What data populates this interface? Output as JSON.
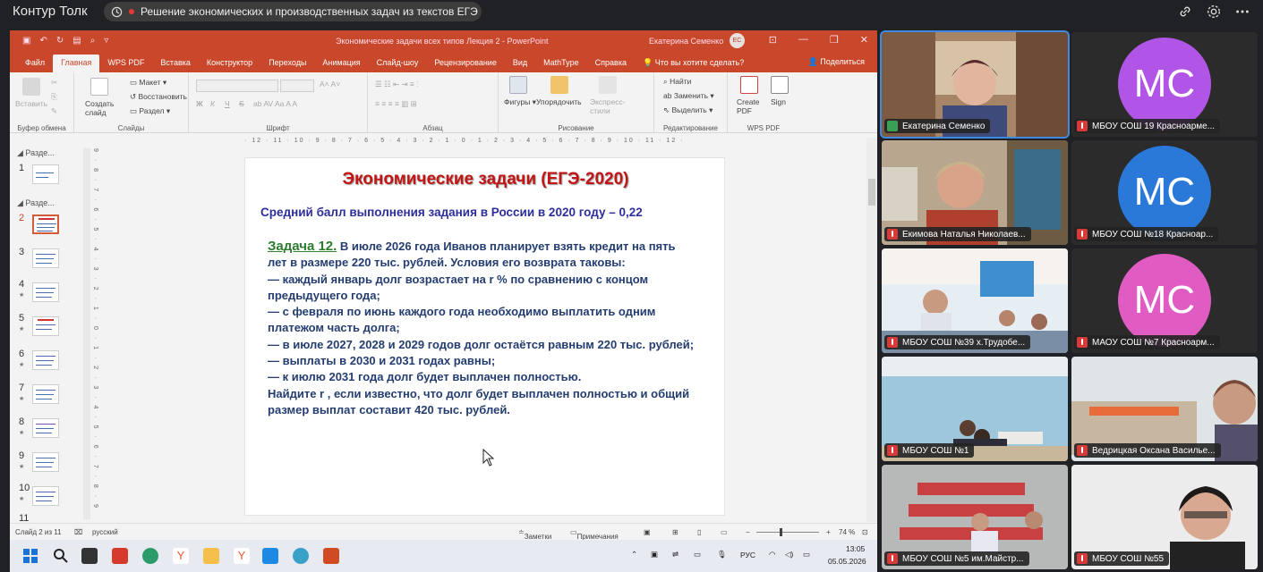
{
  "topbar": {
    "app_title": "Контур Толк",
    "meeting_title": "Решение экономических и производственных задач из текстов ЕГЭ"
  },
  "ppt": {
    "doc_title": "Экономические задачи всех типов Лекция 2  -  PowerPoint",
    "user_name": "Екатерина Семенко",
    "user_initials": "ЕС",
    "tabs": [
      "Файл",
      "Главная",
      "WPS PDF",
      "Вставка",
      "Конструктор",
      "Переходы",
      "Анимация",
      "Слайд-шоу",
      "Рецензирование",
      "Вид",
      "MathType",
      "Справка",
      "Что вы хотите сделать?"
    ],
    "share_label": "Поделиться",
    "ribbon": {
      "insert_label": "Вставить",
      "create_slide_label": "Создать слайд",
      "layout_label": "Макет",
      "restore_label": "Восстановить",
      "section_label": "Раздел",
      "shapes_label": "Фигуры",
      "arrange_label": "Упорядочить",
      "express_styles_label": "Экспресс-стили",
      "find_label": "Найти",
      "replace_label": "Заменить",
      "select_label": "Выделить",
      "create_pdf_label": "Create PDF",
      "sign_label": "Sign",
      "font_bold": "Ж",
      "font_italic": "К",
      "font_underline": "Ч",
      "font_strike": "S",
      "groups": {
        "clipboard": "Буфер обмена",
        "slides": "Слайды",
        "font": "Шрифт",
        "paragraph": "Абзац",
        "drawing": "Рисование",
        "editing": "Редактирование",
        "wpspdf": "WPS PDF"
      }
    },
    "ruler_text": "· 12 · 11 · 10 · 9 · 8 · 7 · 6 · 5 · 4 · 3 · 2 · 1 · 0 · 1 · 2 · 3 · 4 · 5 · 6 · 7 · 8 · 9 · 10 · 11 · 12 ·",
    "vruler_text": "9 · 8 · 7 · 6 · 5 · 4 · 3 · 2 · 1 · 0 · 1 · 2 · 3 · 4 · 5 · 6 · 7 · 8 · 9",
    "thumbs": {
      "section1": "Разде...",
      "section2": "Разде...",
      "numbers": [
        "1",
        "2",
        "3",
        "4",
        "5",
        "6",
        "7",
        "8",
        "9",
        "10",
        "11"
      ],
      "star": "★"
    },
    "slide": {
      "title": "Экономические задачи (ЕГЭ-2020)",
      "subtitle": "Средний балл выполнения задания в России  в 2020 году – 0,22",
      "task_label": "Задача 12.",
      "line1": " В июле 2026 года Иванов планирует взять кредит на пять лет в размере 220 тыс. рублей. Условия его возврата таковы:",
      "line2": "— каждый январь долг возрастает на r % по сравнению с концом предыдущего года;",
      "line3": " — с февраля по июнь каждого года необходимо выплатить одним платежом часть долга;",
      "line4": " — в июле 2027, 2028 и 2029 годов долг остаётся равным 220 тыс. рублей;",
      "line5": "— выплаты в 2030 и 2031 годах равны;",
      "line6": " — к июлю 2031 года долг будет выплачен полностью.",
      "line7": "Найдите r , если известно, что долг будет выплачен полностью и общий размер выплат составит 420 тыс. рублей."
    },
    "status": {
      "slide_info": "Слайд 2 из 11",
      "language": "русский",
      "notes": "Заметки",
      "comments": "Примечания",
      "zoom": "74 %",
      "minus": "−",
      "plus": "+"
    }
  },
  "taskbar": {
    "lang": "РУС",
    "time": "13:05",
    "date": "05.05.2026"
  },
  "participants": [
    {
      "name": "Екатерина Семенко",
      "mic": "on",
      "kind": "video"
    },
    {
      "name": "МБОУ СОШ 19 Красноарме...",
      "mic": "off",
      "kind": "avatar",
      "initials": "МС",
      "color": "#b055e6"
    },
    {
      "name": "Екимова Наталья Николаев...",
      "mic": "off",
      "kind": "video"
    },
    {
      "name": "МБОУ СОШ №18 Красноар...",
      "mic": "off",
      "kind": "avatar",
      "initials": "МС",
      "color": "#2a78d8"
    },
    {
      "name": "МБОУ СОШ №39 х.Трудобе...",
      "mic": "off",
      "kind": "video"
    },
    {
      "name": "МАОУ СОШ №7 Красноарм...",
      "mic": "off",
      "kind": "avatar",
      "initials": "МС",
      "color": "#e05cc3"
    },
    {
      "name": "МБОУ СОШ №1",
      "mic": "off",
      "kind": "video"
    },
    {
      "name": "Ведрицкая Оксана Василье...",
      "mic": "off",
      "kind": "video"
    },
    {
      "name": "МБОУ СОШ №5 им.Майстр...",
      "mic": "off",
      "kind": "video"
    },
    {
      "name": "МБОУ СОШ №55",
      "mic": "off",
      "kind": "video"
    }
  ],
  "colors": {
    "ppt_accent": "#c9472a",
    "active_speaker": "#3d8ae0"
  }
}
